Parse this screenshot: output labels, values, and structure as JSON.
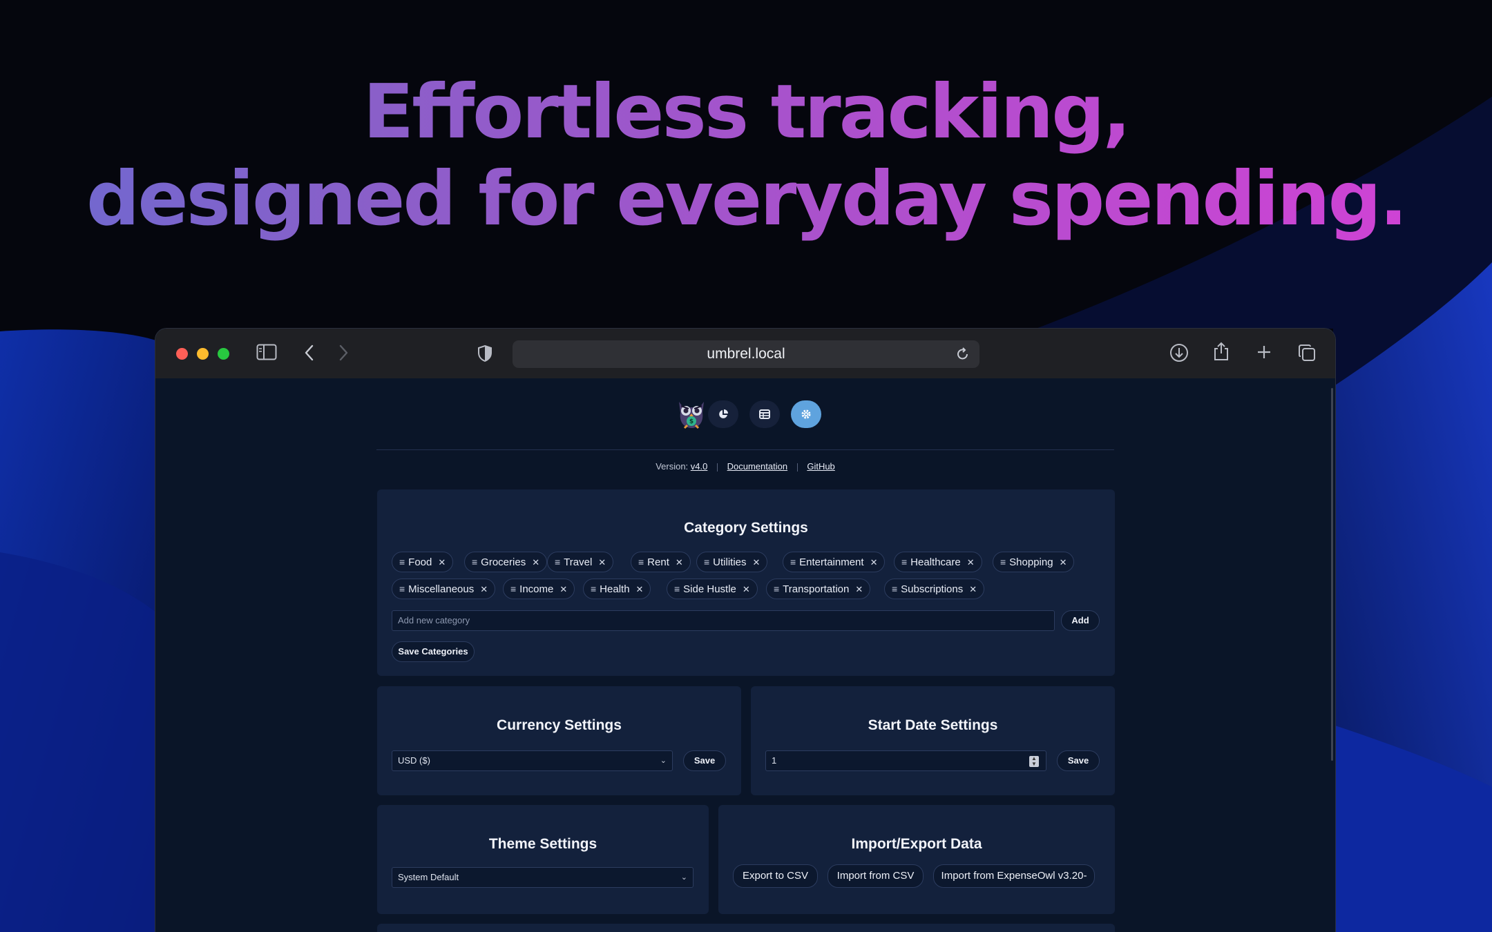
{
  "hero": {
    "line1": "Effortless tracking,",
    "line2": "designed for everyday spending."
  },
  "browser": {
    "url": "umbrel.local",
    "colors": {
      "close": "#ff5f57",
      "minimize": "#febc2e",
      "zoom": "#28c840"
    },
    "toolbar_icons": [
      "sidebar-icon",
      "back-icon",
      "forward-icon",
      "privacy-shield-icon",
      "reload-icon",
      "download-icon",
      "share-icon",
      "new-tab-icon",
      "tabs-overview-icon"
    ]
  },
  "app": {
    "nav": {
      "items": [
        {
          "icon": "pie-chart-icon",
          "active": false
        },
        {
          "icon": "table-icon",
          "active": false
        },
        {
          "icon": "gear-icon",
          "active": true
        }
      ],
      "active_color": "#5fa3de"
    },
    "version": {
      "label": "Version:",
      "value": "v4.0",
      "documentation": "Documentation",
      "github": "GitHub"
    },
    "categories": {
      "title": "Category Settings",
      "items": [
        "Food",
        "Groceries",
        "Travel",
        "Rent",
        "Utilities",
        "Entertainment",
        "Healthcare",
        "Shopping",
        "Miscellaneous",
        "Income",
        "Health",
        "Side Hustle",
        "Transportation",
        "Subscriptions"
      ],
      "input_placeholder": "Add new category",
      "add_label": "Add",
      "save_label": "Save Categories"
    },
    "currency": {
      "title": "Currency Settings",
      "selected": "USD ($)",
      "save_label": "Save"
    },
    "start_date": {
      "title": "Start Date Settings",
      "value": "1",
      "save_label": "Save"
    },
    "theme": {
      "title": "Theme Settings",
      "selected": "System Default"
    },
    "import_export": {
      "title": "Import/Export Data",
      "export_csv": "Export to CSV",
      "import_csv": "Import from CSV",
      "import_legacy": "Import from ExpenseOwl v3.20-"
    }
  }
}
